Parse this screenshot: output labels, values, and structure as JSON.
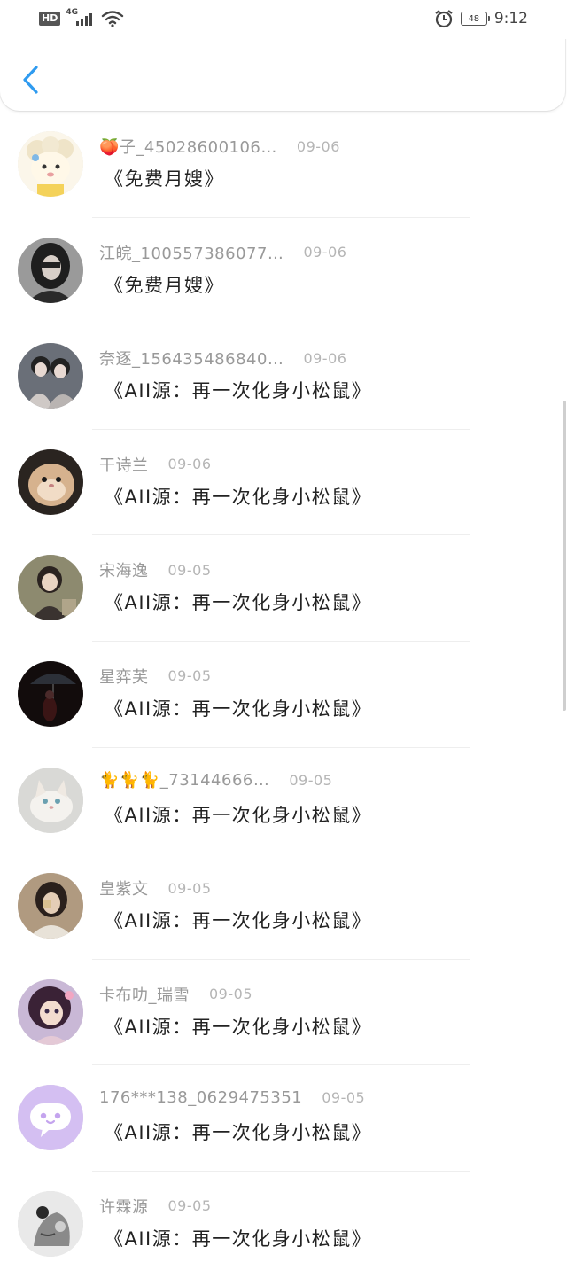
{
  "status_bar": {
    "hd": "HD",
    "network": "4G",
    "battery": "48",
    "time": "9:12"
  },
  "nav": {
    "back_icon": "chevron-left-icon"
  },
  "messages": [
    {
      "name": "🍑子_45028600106…",
      "date": "09-06",
      "text": "《免费月嫂》",
      "avatar": "cartoon-sheep"
    },
    {
      "name": "江皖_100557386077…",
      "date": "09-06",
      "text": "《免费月嫂》",
      "avatar": "girl-photo"
    },
    {
      "name": "奈逐_156435486840…",
      "date": "09-06",
      "text": "《AII源：再一次化身小松鼠》",
      "avatar": "couple-photo"
    },
    {
      "name": "干诗兰",
      "date": "09-06",
      "text": "《AII源：再一次化身小松鼠》",
      "avatar": "hamster-photo"
    },
    {
      "name": "宋海逸",
      "date": "09-05",
      "text": "《AII源：再一次化身小松鼠》",
      "avatar": "child-photo"
    },
    {
      "name": "星弈芙",
      "date": "09-05",
      "text": "《AII源：再一次化身小松鼠》",
      "avatar": "umbrella-photo"
    },
    {
      "name": "🐈🐈🐈_73144666…",
      "date": "09-05",
      "text": "《AII源：再一次化身小松鼠》",
      "avatar": "cat-photo"
    },
    {
      "name": "皇紫文",
      "date": "09-05",
      "text": "《AII源：再一次化身小松鼠》",
      "avatar": "person-photo"
    },
    {
      "name": "卡布叻_瑞雪",
      "date": "09-05",
      "text": "《AII源：再一次化身小松鼠》",
      "avatar": "anime-girl"
    },
    {
      "name": "176***138_0629475351",
      "date": "09-05",
      "text": "《AII源：再一次化身小松鼠》",
      "avatar": "default-chat-icon"
    },
    {
      "name": "许霖源",
      "date": "09-05",
      "text": "《AII源：再一次化身小松鼠》",
      "avatar": "sketch-photo"
    }
  ],
  "colors": {
    "accent": "#2f9bf0",
    "name": "#999999",
    "date": "#b5b5b5",
    "text": "#222222"
  }
}
